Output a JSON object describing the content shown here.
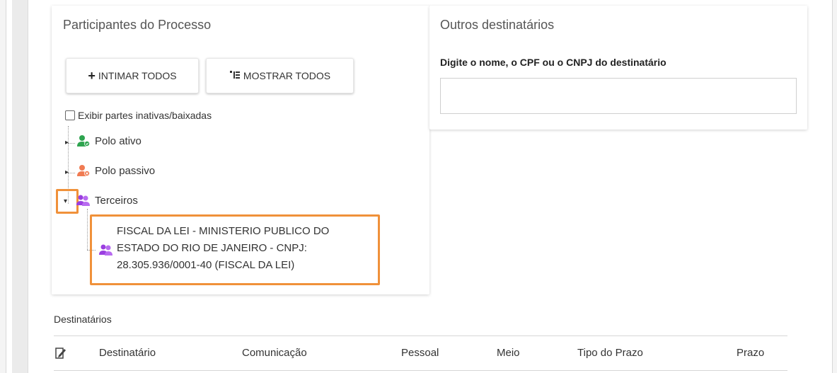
{
  "participants": {
    "title": "Participantes do Processo",
    "btn_intimar": "INTIMAR TODOS",
    "btn_mostrar": "MOSTRAR TODOS",
    "checkbox_label": "Exibir partes inativas/baixadas",
    "tree": {
      "polo_ativo": "Polo ativo",
      "polo_passivo": "Polo passivo",
      "terceiros": "Terceiros",
      "leaf_line1": "FISCAL DA LEI - MINISTERIO PUBLICO DO",
      "leaf_line2": "ESTADO DO RIO DE JANEIRO - CNPJ:",
      "leaf_line3": "28.305.936/0001-40 (FISCAL DA LEI)"
    }
  },
  "outros": {
    "title": "Outros destinatários",
    "field_label": "Digite o nome, o CPF ou o CNPJ do destinatário",
    "field_value": ""
  },
  "destinatarios": {
    "title": "Destinatários",
    "columns": [
      "Destinatário",
      "Comunicação",
      "Pessoal",
      "Meio",
      "Tipo do Prazo",
      "Prazo"
    ]
  },
  "colors": {
    "polo_ativo": "#2ea44f",
    "polo_passivo": "#f07b52",
    "terceiros": "#9b3fe0",
    "highlight": "#f0913a"
  }
}
